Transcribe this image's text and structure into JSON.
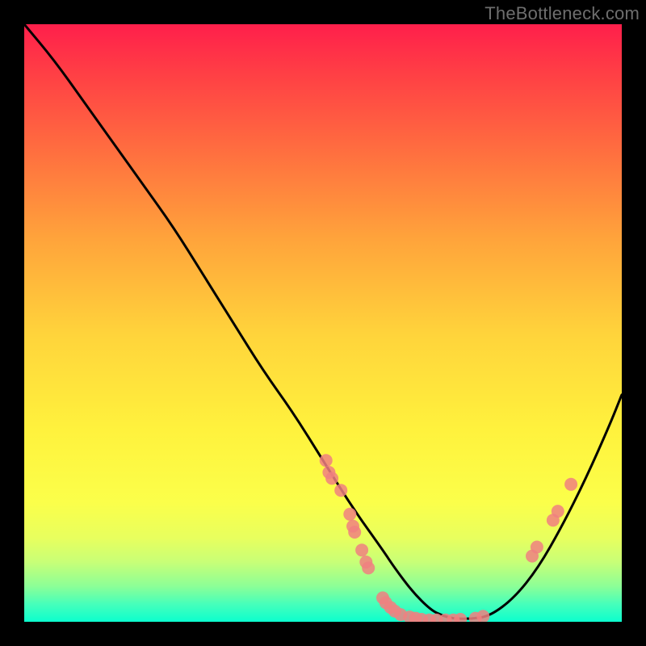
{
  "watermark": "TheBottleneck.com",
  "colors": {
    "curve_stroke": "#000000",
    "dot_fill": "#f08080",
    "dot_stroke": "#f08080",
    "background": "#000000"
  },
  "chart_data": {
    "type": "line",
    "title": "",
    "xlabel": "",
    "ylabel": "",
    "xlim": [
      0,
      100
    ],
    "ylim": [
      0,
      100
    ],
    "grid": false,
    "series": [
      {
        "name": "bottleneck-curve",
        "x": [
          0,
          5,
          10,
          15,
          20,
          25,
          30,
          35,
          40,
          45,
          50,
          55,
          60,
          62,
          65,
          68,
          70,
          72,
          75,
          78,
          82,
          86,
          90,
          94,
          98,
          100
        ],
        "y": [
          100,
          94,
          87,
          80,
          73,
          66,
          58,
          50,
          42,
          35,
          27,
          19,
          12,
          9,
          5,
          2,
          1,
          0.5,
          0.5,
          1,
          4,
          9,
          16,
          24,
          33,
          38
        ]
      }
    ],
    "dots": [
      {
        "x": 50.5,
        "y": 27
      },
      {
        "x": 51.0,
        "y": 25
      },
      {
        "x": 51.5,
        "y": 24
      },
      {
        "x": 53.0,
        "y": 22
      },
      {
        "x": 54.5,
        "y": 18
      },
      {
        "x": 55.0,
        "y": 16
      },
      {
        "x": 55.3,
        "y": 15
      },
      {
        "x": 56.5,
        "y": 12
      },
      {
        "x": 57.2,
        "y": 10
      },
      {
        "x": 57.6,
        "y": 9
      },
      {
        "x": 60.0,
        "y": 4
      },
      {
        "x": 60.5,
        "y": 3.2
      },
      {
        "x": 61.3,
        "y": 2.4
      },
      {
        "x": 62.0,
        "y": 1.8
      },
      {
        "x": 63.0,
        "y": 1.2
      },
      {
        "x": 64.5,
        "y": 0.8
      },
      {
        "x": 65.5,
        "y": 0.6
      },
      {
        "x": 66.5,
        "y": 0.4
      },
      {
        "x": 67.8,
        "y": 0.3
      },
      {
        "x": 69.0,
        "y": 0.3
      },
      {
        "x": 70.5,
        "y": 0.3
      },
      {
        "x": 71.8,
        "y": 0.3
      },
      {
        "x": 73.0,
        "y": 0.4
      },
      {
        "x": 75.5,
        "y": 0.6
      },
      {
        "x": 76.8,
        "y": 0.9
      },
      {
        "x": 85.0,
        "y": 11
      },
      {
        "x": 85.8,
        "y": 12.5
      },
      {
        "x": 88.5,
        "y": 17
      },
      {
        "x": 89.3,
        "y": 18.5
      },
      {
        "x": 91.5,
        "y": 23
      }
    ],
    "dot_radius_px": 8,
    "curve_stroke_px": 3
  }
}
